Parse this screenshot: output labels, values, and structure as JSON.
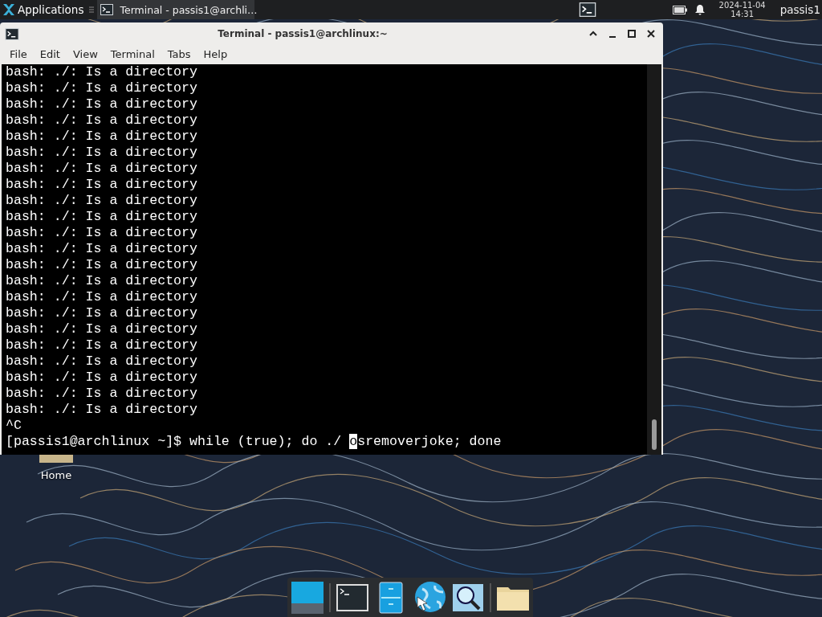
{
  "top_panel": {
    "applications_label": "Applications",
    "task_title": "Terminal - passis1@archli…",
    "date": "2024-11-04",
    "time": "14:31",
    "user": "passis1"
  },
  "window": {
    "title": "Terminal - passis1@archlinux:~",
    "menu": [
      "File",
      "Edit",
      "View",
      "Terminal",
      "Tabs",
      "Help"
    ],
    "output_lines": [
      "bash: ./: Is a directory",
      "bash: ./: Is a directory",
      "bash: ./: Is a directory",
      "bash: ./: Is a directory",
      "bash: ./: Is a directory",
      "bash: ./: Is a directory",
      "bash: ./: Is a directory",
      "bash: ./: Is a directory",
      "bash: ./: Is a directory",
      "bash: ./: Is a directory",
      "bash: ./: Is a directory",
      "bash: ./: Is a directory",
      "bash: ./: Is a directory",
      "bash: ./: Is a directory",
      "bash: ./: Is a directory",
      "bash: ./: Is a directory",
      "bash: ./: Is a directory",
      "bash: ./: Is a directory",
      "bash: ./: Is a directory",
      "bash: ./: Is a directory",
      "bash: ./: Is a directory",
      "bash: ./: Is a directory",
      "^C"
    ],
    "prompt": {
      "before_cursor": "[passis1@archlinux ~]$ while (true); do ./ ",
      "cursor_char": "o",
      "after_cursor": "sremoverjoke; done"
    }
  },
  "desktop_icons": [
    {
      "label": "Home"
    }
  ]
}
